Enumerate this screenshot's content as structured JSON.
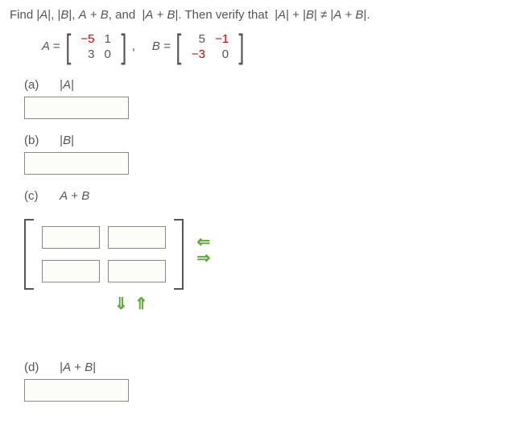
{
  "problem": {
    "intro": "Find |A|, |B|, A + B, and  |A + B|. Then verify that  |A| + |B| ≠ |A + B|.",
    "A_label": "A =",
    "B_label": "B =",
    "comma": ",",
    "A": {
      "r1c1": "−5",
      "r1c2": "1",
      "r2c1": "3",
      "r2c2": "0"
    },
    "B": {
      "r1c1": "5",
      "r1c2": "−1",
      "r2c1": "−3",
      "r2c2": "0"
    }
  },
  "parts": {
    "a": {
      "label": "(a)",
      "title": "|A|"
    },
    "b": {
      "label": "(b)",
      "title": "|B|"
    },
    "c": {
      "label": "(c)",
      "title": "A + B"
    },
    "d": {
      "label": "(d)",
      "title": "|A + B|"
    }
  },
  "arrows": {
    "left": "⇐",
    "right": "⇒",
    "down": "⇓",
    "up": "⇑"
  },
  "chart_data": {
    "type": "table",
    "matrices": {
      "A": [
        [
          -5,
          1
        ],
        [
          3,
          0
        ]
      ],
      "B": [
        [
          5,
          -1
        ],
        [
          -3,
          0
        ]
      ]
    }
  }
}
